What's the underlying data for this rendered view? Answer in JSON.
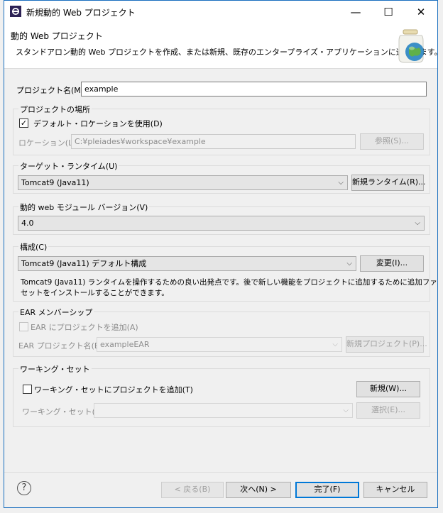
{
  "window": {
    "title": "新規動的 Web プロジェクト",
    "minimize": "—",
    "maximize": "☐",
    "close": "✕"
  },
  "banner": {
    "title": "動的 Web プロジェクト",
    "description": "スタンドアロン動的 Web プロジェクトを作成、または新規、既存のエンタープライズ・アプリケーションに追加します。"
  },
  "project_name": {
    "label": "プロジェクト名(M):",
    "value": "example"
  },
  "location": {
    "legend": "プロジェクトの場所",
    "use_default_label": "デフォルト・ロケーションを使用(D)",
    "use_default_checked": "✓",
    "location_label": "ロケーション(L):",
    "location_value": "C:¥pleiades¥workspace¥example",
    "browse_button": "参照(S)..."
  },
  "target_runtime": {
    "legend": "ターゲット・ランタイム(U)",
    "selected": "Tomcat9 (Java11)",
    "new_runtime_button": "新規ランタイム(R)..."
  },
  "module_version": {
    "legend": "動的 web モジュール バージョン(V)",
    "selected": "4.0"
  },
  "configuration": {
    "legend": "構成(C)",
    "selected": "Tomcat9 (Java11) デフォルト構成",
    "modify_button": "変更(I)...",
    "description_line1": "Tomcat9 (Java11) ランタイムを操作するための良い出発点です。後で新しい機能をプロジェクトに追加するために追加ファ",
    "description_line2": "セットをインストールすることができます。"
  },
  "ear": {
    "legend": "EAR メンバーシップ",
    "add_label": "EAR にプロジェクトを追加(A)",
    "name_label": "EAR プロジェクト名(E):",
    "name_value": "exampleEAR",
    "new_project_button": "新規プロジェクト(P)..."
  },
  "working_set": {
    "legend": "ワーキング・セット",
    "add_label": "ワーキング・セットにプロジェクトを追加(T)",
    "new_button": "新規(W)...",
    "sets_label": "ワーキング・セット(O):",
    "select_button": "選択(E)..."
  },
  "footer": {
    "help": "?",
    "back_button": "< 戻る(B)",
    "next_button": "次へ(N) >",
    "finish_button": "完了(F)",
    "cancel_button": "キャンセル"
  },
  "icons": {
    "chevron": "⌵"
  }
}
